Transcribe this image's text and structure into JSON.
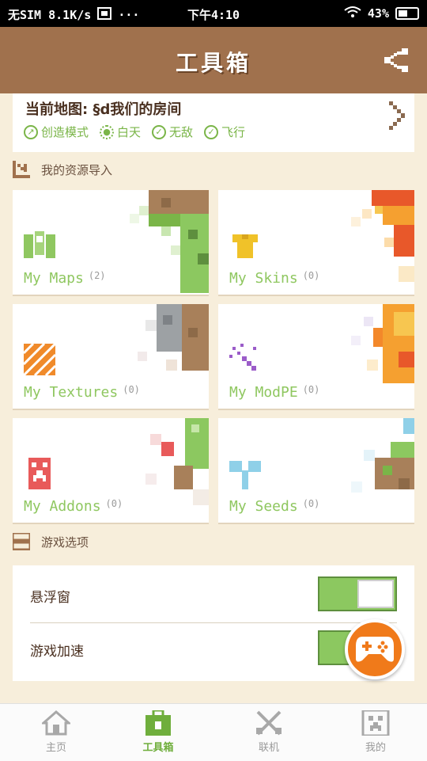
{
  "status": {
    "carrier": "无SIM 8.1K/s",
    "more": "···",
    "time": "下午4:10",
    "battery": "43%"
  },
  "header": {
    "title": "工具箱"
  },
  "map": {
    "title": "当前地图: §d我们的房间",
    "tags": [
      {
        "label": "创造模式",
        "icon": "arrow-circle-icon"
      },
      {
        "label": "白天",
        "icon": "sun-icon"
      },
      {
        "label": "无敌",
        "icon": "check-circle-icon"
      },
      {
        "label": "飞行",
        "icon": "check-circle-icon"
      }
    ]
  },
  "resources": {
    "section_title": "我的资源导入",
    "tiles": [
      {
        "label": "My Maps",
        "count": "(2)"
      },
      {
        "label": "My Skins",
        "count": "(0)"
      },
      {
        "label": "My Textures",
        "count": "(0)"
      },
      {
        "label": "My ModPE",
        "count": "(0)"
      },
      {
        "label": "My Addons",
        "count": "(0)"
      },
      {
        "label": "My Seeds",
        "count": "(0)"
      }
    ]
  },
  "options": {
    "section_title": "游戏选项",
    "rows": [
      {
        "label": "悬浮窗",
        "enabled": true
      },
      {
        "label": "游戏加速",
        "enabled": true
      }
    ]
  },
  "tabs": [
    {
      "label": "主页",
      "icon": "home-icon",
      "active": false
    },
    {
      "label": "工具箱",
      "icon": "toolbox-icon",
      "active": true
    },
    {
      "label": "联机",
      "icon": "crossed-swords-icon",
      "active": false
    },
    {
      "label": "我的",
      "icon": "creeper-face-icon",
      "active": false
    }
  ],
  "colors": {
    "header": "#a0714d",
    "background": "#f7eedb",
    "accent_green": "#8cc860",
    "game_button": "#f07a1a"
  }
}
